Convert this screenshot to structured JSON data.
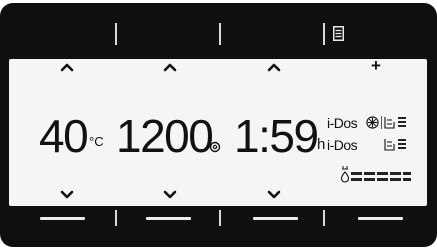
{
  "temperature": {
    "value": "40",
    "unit": "°C"
  },
  "spin": {
    "value": "1200",
    "icon": "spin-icon"
  },
  "time": {
    "value": "1:59",
    "unit": "h"
  },
  "idos": {
    "line1": "i-Dos",
    "line2": "i-Dos"
  },
  "icons": {
    "top_right": "document-icon",
    "plus": "+",
    "fan": "fan-icon",
    "dispenser1": "dispenser-icon",
    "dispenser2": "dispenser-icon",
    "water_drop": "water-drop-icon"
  },
  "colors": {
    "panel": "#0f0f0f",
    "screen": "#f5f5f5",
    "text": "#111111",
    "divider": "#d9d9d9"
  }
}
